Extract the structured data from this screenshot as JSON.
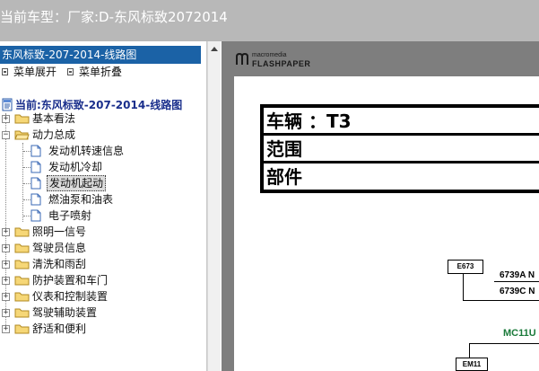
{
  "title_bar": {
    "text": "当前车型：厂家:D-东风标致2072014"
  },
  "sidebar": {
    "document_title": "东风标致-207-2014-线路图",
    "expand_label": "菜单展开",
    "collapse_label": "菜单折叠",
    "root_label": "当前:东风标致-207-2014-线路图",
    "items": [
      {
        "label": "基本看法",
        "expanded": false
      },
      {
        "label": "动力总成",
        "expanded": true,
        "children": [
          {
            "label": "发动机转速信息"
          },
          {
            "label": "发动机冷却"
          },
          {
            "label": "发动机起动",
            "selected": true
          },
          {
            "label": "燃油泵和油表"
          },
          {
            "label": "电子喷射"
          }
        ]
      },
      {
        "label": "照明一信号",
        "expanded": false
      },
      {
        "label": "驾驶员信息",
        "expanded": false
      },
      {
        "label": "清洗和雨刮",
        "expanded": false
      },
      {
        "label": "防护装置和车门",
        "expanded": false
      },
      {
        "label": "仪表和控制装置",
        "expanded": false
      },
      {
        "label": "驾驶辅助装置",
        "expanded": false
      },
      {
        "label": "舒适和便利",
        "expanded": false
      }
    ]
  },
  "viewer": {
    "logo_line1": "macromedia",
    "logo_line2": "FLASHPAPER",
    "info_rows": [
      "车辆 ：T3",
      "范围",
      "部件"
    ],
    "diagram": {
      "connector_1": "E673",
      "pin_1": "6739A N",
      "pin_2": "6739C N",
      "module": "MC11U",
      "connector_2": "EM11"
    }
  },
  "colors": {
    "title_bar_bg": "#b8b8b8",
    "selected_bar_bg": "#1b62a6",
    "viewer_bg": "#7e7e7e",
    "root_label_color": "#1a2f8c",
    "module_label_color": "#1a7a3a"
  },
  "icons": [
    "folder-icon",
    "page-icon",
    "document-icon",
    "flashpaper-logo-icon",
    "scroll-up-arrow-icon"
  ]
}
